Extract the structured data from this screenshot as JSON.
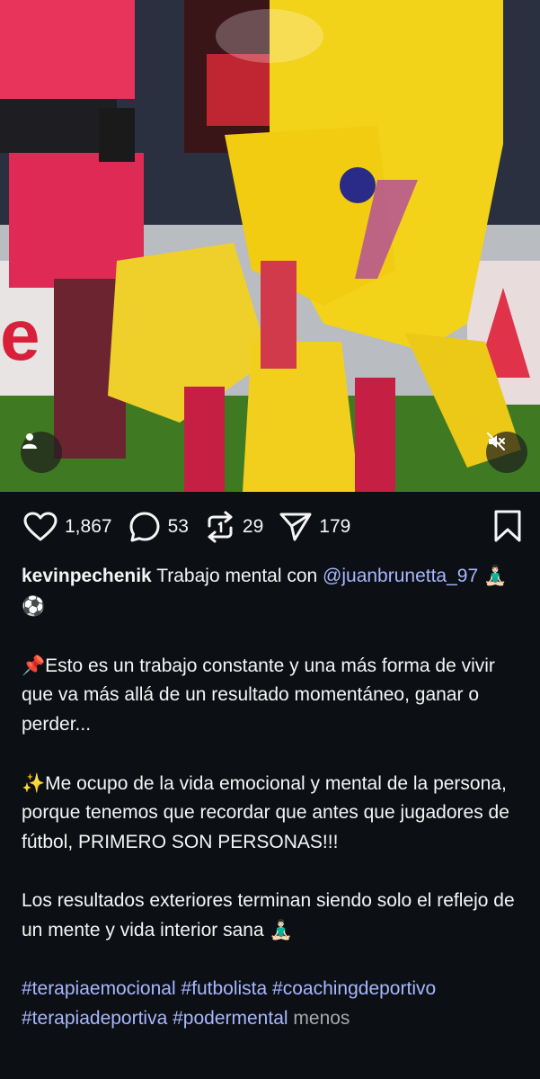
{
  "post": {
    "likes": "1,867",
    "comments": "53",
    "reposts": "29",
    "shares": "179"
  },
  "icons": {
    "like": "heart-icon",
    "comment": "comment-bubble-icon",
    "repost": "repost-icon",
    "share": "paper-plane-icon",
    "save": "bookmark-icon",
    "user_tags": "person-icon",
    "audio": "muted-speaker-icon"
  },
  "caption": {
    "username": "kevinpechenik",
    "intro": "Trabajo mental con",
    "mention": "@juanbrunetta_97",
    "intro_emojis": "🧘🏻‍♂️⚽",
    "para1_emoji": "📌",
    "para1": "Esto es un trabajo constante y una más forma de vivir que va más allá de un resultado momentáneo, ganar o perder...",
    "para2_emoji": "✨",
    "para2": "Me ocupo de la vida emocional y mental de la persona, porque tenemos que recordar que antes que jugadores de fútbol, PRIMERO SON PERSONAS!!!",
    "para3": "Los resultados exteriores terminan siendo solo el reflejo de un mente y vida interior sana",
    "para3_emoji": "🧘🏻‍♂️",
    "hashtags": [
      "#terapiaemocional",
      "#futbolista",
      "#coachingdeportivo",
      "#terapiadeportiva",
      "#podermental"
    ],
    "less_label": "menos"
  },
  "colors": {
    "background": "#0c1014",
    "link": "#a8b6ff",
    "text": "#f5f5f5",
    "muted": "#a8a8a8"
  }
}
